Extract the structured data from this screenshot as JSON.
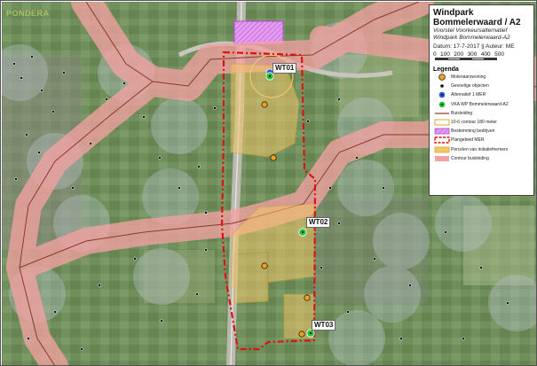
{
  "map": {
    "logo_text": "PONDERA",
    "colors": {
      "study_area_border": "#e01010",
      "pipeline_zone": "#f3a2a2",
      "turbine_green": "#22c040",
      "dwelling_orange": "#f0a020",
      "alt_blue": "#2a55d8",
      "initiative_plot": "#f2c66a",
      "business_zone": "#d87af0"
    },
    "turbines": [
      {
        "label": "WT01"
      },
      {
        "label": "WT02"
      },
      {
        "label": "WT03"
      }
    ]
  },
  "panel": {
    "title_line1": "Windpark",
    "title_line2": "Bommelerwaard / A2",
    "subtitle_line1": "Voorstel Voorkeursalternatief",
    "subtitle_line2": "Windpark Bommelerwaard-A2",
    "date_line": "Datum: 17-7-2017 || Auteur: ME",
    "scale_labels": [
      "0",
      "100",
      "200",
      "300",
      "400",
      "500"
    ],
    "legend_title": "Legenda",
    "legend": [
      {
        "label": "Molenaarswoning",
        "icon": "orange-circle"
      },
      {
        "label": "Gevoelige objecten",
        "icon": "small-black-dot"
      },
      {
        "label": "Alternatief 1 MER",
        "icon": "blue-circle"
      },
      {
        "label": "VKA WP Bommelerwaard-A2",
        "icon": "green-circle"
      },
      {
        "label": "Buisleiding",
        "icon": "brown-line"
      },
      {
        "label": "10-6 contour 180 meter",
        "icon": "orange-outline-box"
      },
      {
        "label": "Bestemming bedrijven",
        "icon": "magenta-hatched-box"
      },
      {
        "label": "Plangebied MER",
        "icon": "red-dashed-box"
      },
      {
        "label": "Percelen van initiatiefnemers",
        "icon": "orange-filled-box"
      },
      {
        "label": "Contour buisleiding",
        "icon": "pink-box"
      }
    ]
  }
}
